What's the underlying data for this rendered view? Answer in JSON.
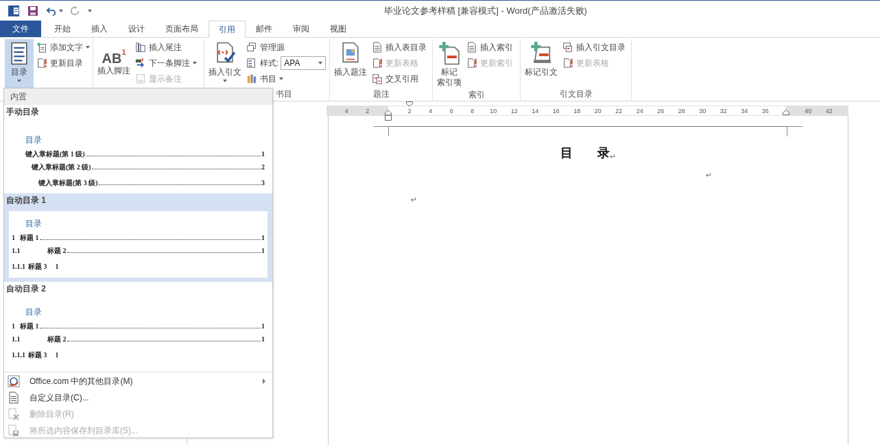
{
  "window": {
    "title": "毕业论文参考样稿 [兼容模式] - Word(产品激活失败)"
  },
  "tabs": [
    {
      "label": "文件",
      "kind": "file",
      "selected": false
    },
    {
      "label": "开始",
      "kind": "tab",
      "selected": false
    },
    {
      "label": "插入",
      "kind": "tab",
      "selected": false
    },
    {
      "label": "设计",
      "kind": "tab",
      "selected": false
    },
    {
      "label": "页面布局",
      "kind": "tab",
      "selected": false
    },
    {
      "label": "引用",
      "kind": "tab",
      "selected": true
    },
    {
      "label": "邮件",
      "kind": "tab",
      "selected": false
    },
    {
      "label": "审阅",
      "kind": "tab",
      "selected": false
    },
    {
      "label": "视图",
      "kind": "tab",
      "selected": false
    }
  ],
  "ribbon_groups": [
    {
      "items": [
        {
          "kind": "large",
          "label": [
            "目录"
          ],
          "dropdown": true,
          "selected": true
        },
        {
          "kind": "column",
          "items": [
            {
              "label": "添加文字",
              "dropdown": true,
              "disabled": false
            },
            {
              "label": "更新目录",
              "dropdown": false,
              "disabled": false
            }
          ]
        }
      ]
    },
    {
      "items": [
        {
          "kind": "large",
          "glyph": "AB$^{1}$",
          "label": [
            "插入脚注"
          ],
          "dropdown": false,
          "selected": false
        },
        {
          "kind": "column",
          "items": [
            {
              "label": "插入尾注",
              "dropdown": false,
              "disabled": false
            },
            {
              "label": "下一条脚注",
              "dropdown": true,
              "disabled": false
            },
            {
              "label": "显示备注",
              "dropdown": false,
              "disabled": true
            }
          ]
        }
      ]
    },
    {
      "label": "书目",
      "items": [
        {
          "kind": "large",
          "label": [
            "插入引文"
          ],
          "dropdown": true,
          "selected": false
        },
        {
          "kind": "column",
          "items": [
            {
              "label": "管理源",
              "dropdown": false,
              "disabled": false
            },
            {
              "label": "样式:",
              "dropdown": false,
              "disabled": false,
              "select": "APA"
            },
            {
              "label": "书目",
              "dropdown": true,
              "disabled": false
            }
          ]
        }
      ]
    },
    {
      "label": "题注",
      "items": [
        {
          "kind": "large",
          "label": [
            "插入题注"
          ],
          "dropdown": false,
          "selected": false
        },
        {
          "kind": "column",
          "items": [
            {
              "label": "插入表目录",
              "dropdown": false,
              "disabled": false
            },
            {
              "label": "更新表格",
              "dropdown": false,
              "disabled": true
            },
            {
              "label": "交叉引用",
              "dropdown": false,
              "disabled": false
            }
          ]
        }
      ]
    },
    {
      "label": "索引",
      "items": [
        {
          "kind": "large",
          "label": [
            "标记",
            "索引项"
          ],
          "dropdown": false,
          "selected": false
        },
        {
          "kind": "column",
          "items": [
            {
              "label": "插入索引",
              "dropdown": false,
              "disabled": false
            },
            {
              "label": "更新索引",
              "dropdown": false,
              "disabled": true
            }
          ]
        }
      ]
    },
    {
      "label": "引文目录",
      "items": [
        {
          "kind": "large",
          "label": [
            "标记引文"
          ],
          "dropdown": false,
          "selected": false
        },
        {
          "kind": "column",
          "items": [
            {
              "label": "插入引文目录",
              "dropdown": false,
              "disabled": false
            },
            {
              "label": "更新表格",
              "dropdown": false,
              "disabled": true
            }
          ]
        }
      ]
    }
  ],
  "ruler": [
    {
      "label": "4",
      "margin": true
    },
    {
      "label": "2",
      "margin": true
    },
    {
      "label": "2",
      "margin": false
    },
    {
      "label": "4",
      "margin": false
    },
    {
      "label": "6",
      "margin": false
    },
    {
      "label": "8",
      "margin": false
    },
    {
      "label": "10",
      "margin": false
    },
    {
      "label": "12",
      "margin": false
    },
    {
      "label": "14",
      "margin": false
    },
    {
      "label": "16",
      "margin": false
    },
    {
      "label": "18",
      "margin": false
    },
    {
      "label": "20",
      "margin": false
    },
    {
      "label": "22",
      "margin": false
    },
    {
      "label": "24",
      "margin": false
    },
    {
      "label": "26",
      "margin": false
    },
    {
      "label": "28",
      "margin": false
    },
    {
      "label": "30",
      "margin": false
    },
    {
      "label": "32",
      "margin": false
    },
    {
      "label": "34",
      "margin": false
    },
    {
      "label": "36",
      "margin": false
    },
    {
      "label": "40",
      "margin": true
    },
    {
      "label": "42",
      "margin": true
    }
  ],
  "document": {
    "heading": "目　　录",
    "paragraph_mark": "↵"
  },
  "menu": {
    "section": "内置",
    "gallery": [
      {
        "title": "手动目录",
        "selected": false,
        "preview": {
          "heading": "目录",
          "entries": [
            {
              "text": "键入章标题(第 1 级)",
              "page": "1",
              "leader": true
            },
            {
              "text": "键入章标题(第 2 级)",
              "page": "2",
              "leader": true
            },
            {
              "text": "键入章标题(第 3 级)",
              "page": "3",
              "leader": true
            }
          ]
        }
      },
      {
        "title": "自动目录 1",
        "selected": true,
        "preview": {
          "heading": "目录",
          "entries": [
            {
              "number": "1",
              "text": "标题 1",
              "page": "1",
              "leader": true
            },
            {
              "number": "1.1",
              "text": "标题 2",
              "page": "1",
              "leader": true
            },
            {
              "number": "1.1.1",
              "text": "标题 3",
              "page": "1",
              "leader": false
            }
          ]
        }
      },
      {
        "title": "自动目录 2",
        "selected": false,
        "preview": {
          "heading": "目录",
          "entries": [
            {
              "number": "1",
              "text": "标题 1",
              "page": "1",
              "leader": true
            },
            {
              "number": "1.1",
              "text": "标题 2",
              "page": "1",
              "leader": true
            },
            {
              "number": "1.1.1",
              "text": "标题 3",
              "page": "1",
              "leader": false
            }
          ]
        }
      }
    ],
    "commands": [
      {
        "label": "Office.com 中的其他目录(M)",
        "submenu": true,
        "disabled": false
      },
      {
        "label": "自定义目录(C)...",
        "submenu": false,
        "disabled": false
      },
      {
        "label": "删除目录(R)",
        "submenu": false,
        "disabled": true
      },
      {
        "label": "将所选内容保存到目录库(S)...",
        "submenu": false,
        "disabled": true
      }
    ]
  }
}
